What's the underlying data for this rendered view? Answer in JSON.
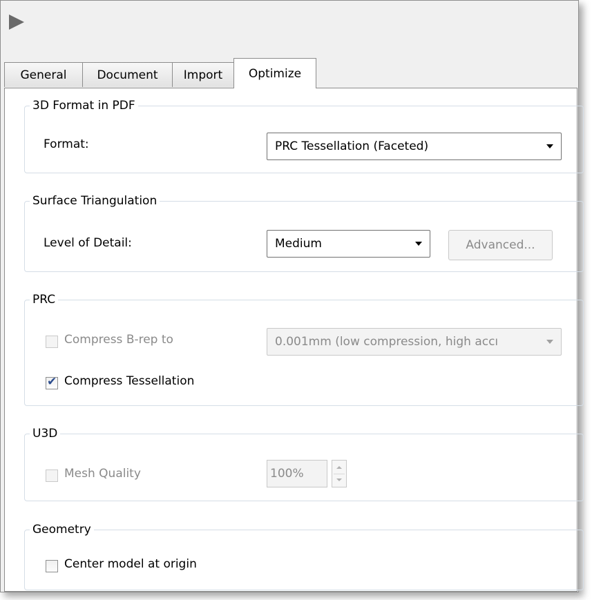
{
  "tabs": [
    {
      "label": "General"
    },
    {
      "label": "Document"
    },
    {
      "label": "Import"
    },
    {
      "label": "Optimize",
      "active": true
    }
  ],
  "groups": {
    "format3d": {
      "title": "3D Format in PDF",
      "format_label": "Format:",
      "format_value": "PRC Tessellation (Faceted)"
    },
    "surface": {
      "title": "Surface Triangulation",
      "lod_label": "Level of Detail:",
      "lod_value": "Medium",
      "advanced_label": "Advanced..."
    },
    "prc": {
      "title": "PRC",
      "brep_label": "Compress B-rep to",
      "brep_checked": false,
      "brep_enabled": false,
      "brep_value": "0.001mm (low compression, high accı",
      "tess_label": "Compress Tessellation",
      "tess_checked": true
    },
    "u3d": {
      "title": "U3D",
      "mesh_label": "Mesh Quality",
      "mesh_checked": false,
      "mesh_value": "100%"
    },
    "geometry": {
      "title": "Geometry",
      "center_label": "Center model at origin",
      "center_checked": false
    }
  },
  "icons": {
    "run": "play-triangle-icon"
  },
  "colors": {
    "window_bg": "#f0f0f0",
    "panel_bg": "#ffffff",
    "checkmark": "#2c4d8e",
    "disabled_text": "#8a8a8a"
  }
}
